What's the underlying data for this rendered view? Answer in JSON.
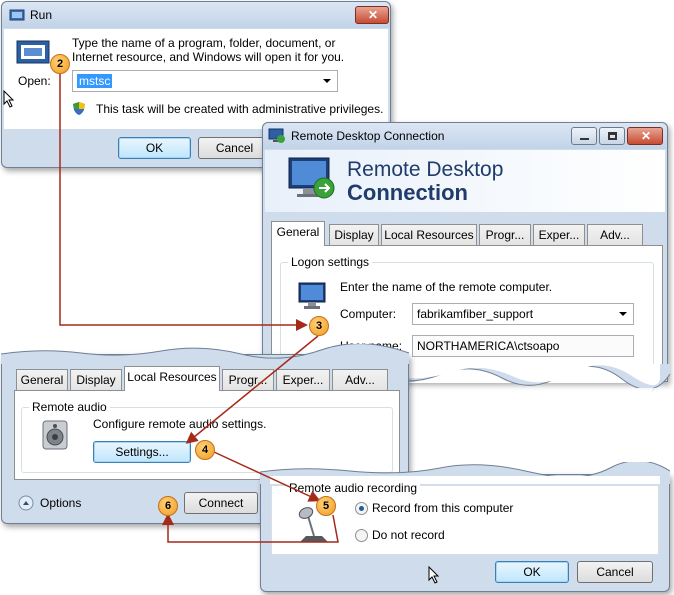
{
  "run": {
    "title": "Run",
    "description": "Type the name of a program, folder, document, or Internet resource, and Windows will open it for you.",
    "open_label": "Open:",
    "open_value": "mstsc",
    "admin_note": "This task will be created with administrative privileges.",
    "ok": "OK",
    "cancel": "Cancel"
  },
  "rdc": {
    "title": "Remote Desktop Connection",
    "banner_line1": "Remote Desktop",
    "banner_line2": "Connection",
    "tabs": [
      "General",
      "Display",
      "Local Resources",
      "Progr...",
      "Exper...",
      "Adv..."
    ],
    "logon_group": "Logon settings",
    "logon_text": "Enter the name of the remote computer.",
    "computer_label": "Computer:",
    "computer_value": "fabrikamfiber_support",
    "username_label": "User name:",
    "username_value": "NORTHAMERICA\\ctsoapo"
  },
  "local": {
    "tabs": [
      "General",
      "Display",
      "Local Resources",
      "Progr...",
      "Exper...",
      "Adv..."
    ],
    "audio_group": "Remote audio",
    "audio_text": "Configure remote audio settings.",
    "settings": "Settings...",
    "options": "Options",
    "connect": "Connect"
  },
  "recording": {
    "group": "Remote audio recording",
    "option1": "Record from this computer",
    "option2": "Do not record",
    "ok": "OK",
    "cancel": "Cancel"
  },
  "callouts": [
    "2",
    "3",
    "4",
    "5",
    "6"
  ],
  "colors": {
    "arrow": "#a52a1a",
    "selection": "#3399ff",
    "callout": "#f39a1e"
  }
}
